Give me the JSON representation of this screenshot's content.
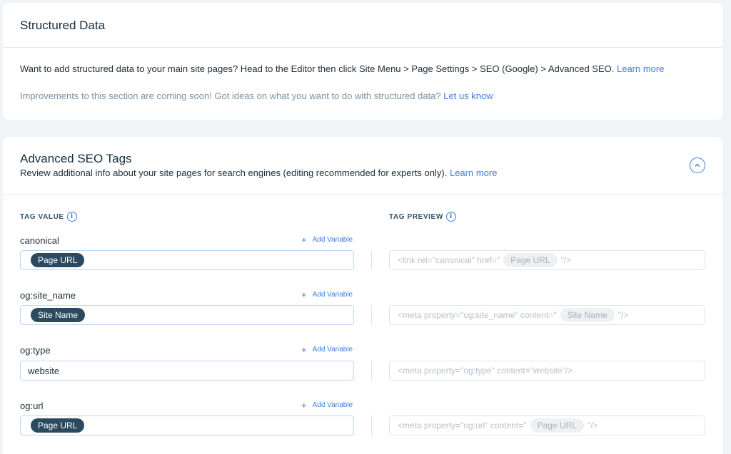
{
  "structured_data": {
    "title": "Structured Data",
    "description": "Want to add structured data to your main site pages? Head to the Editor then click Site Menu > Page Settings > SEO (Google) > Advanced SEO.",
    "learn_more": "Learn more",
    "improvements": "Improvements to this section are coming soon! Got ideas on what you want to do with structured data?",
    "let_us_know": "Let us know"
  },
  "advanced": {
    "title": "Advanced SEO Tags",
    "subtitle": "Review additional info about your site pages for search engines (editing recommended for experts only).",
    "learn_more": "Learn more",
    "collapse_icon": "chevron-up-icon",
    "col_value": "TAG VALUE",
    "col_preview": "TAG PREVIEW",
    "info_glyph": "i",
    "add_variable": "Add Variable",
    "add_glyph": "+",
    "rows": [
      {
        "label": "canonical",
        "value_chip": "Page URL",
        "preview_before": "<link rel=\"canonical\" href=\"",
        "preview_chip": "Page URL",
        "preview_after": "\"/>"
      },
      {
        "label": "og:site_name",
        "value_chip": "Site Name",
        "preview_before": "<meta property=\"og:site_name\" content=\"",
        "preview_chip": "Site Name",
        "preview_after": "\"/>"
      },
      {
        "label": "og:type",
        "value_text": "website",
        "preview_text": "<meta property=\"og:type\" content=\"website\"/>"
      },
      {
        "label": "og:url",
        "value_chip": "Page URL",
        "preview_before": "<meta property=\"og:url\" content=\"",
        "preview_chip": "Page URL",
        "preview_after": "\"/>"
      }
    ]
  },
  "colors": {
    "accent": "#3b7de0",
    "chip": "#2b4a60",
    "background": "#f0f4f7"
  }
}
